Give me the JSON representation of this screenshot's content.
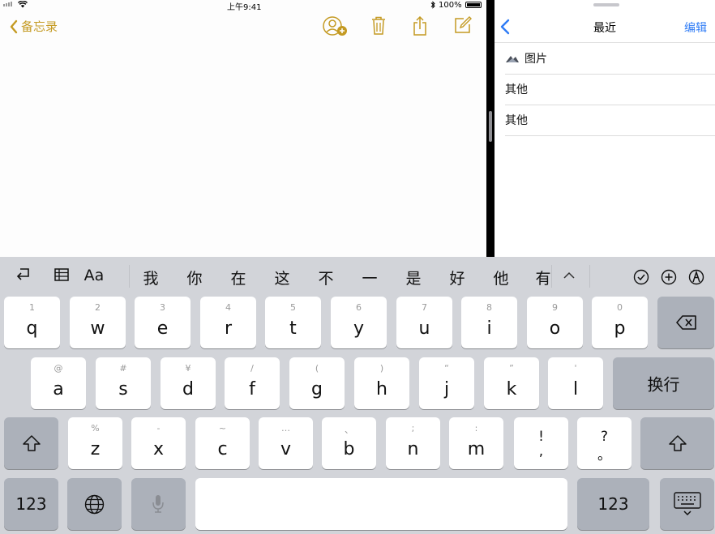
{
  "status": {
    "time": "上午9:41",
    "battery": "100%"
  },
  "notes": {
    "back_label": "备忘录"
  },
  "side": {
    "title": "最近",
    "edit_label": "编辑",
    "rows": [
      {
        "label": "图片",
        "icon": "image-icon"
      },
      {
        "label": "其他"
      },
      {
        "label": "其他"
      }
    ]
  },
  "keyboard": {
    "format_label": "Aa",
    "candidates": [
      "我",
      "你",
      "在",
      "这",
      "不",
      "一",
      "是",
      "好",
      "他",
      "有"
    ],
    "row1": [
      {
        "k": "q",
        "s": "1"
      },
      {
        "k": "w",
        "s": "2"
      },
      {
        "k": "e",
        "s": "3"
      },
      {
        "k": "r",
        "s": "4"
      },
      {
        "k": "t",
        "s": "5"
      },
      {
        "k": "y",
        "s": "6"
      },
      {
        "k": "u",
        "s": "7"
      },
      {
        "k": "i",
        "s": "8"
      },
      {
        "k": "o",
        "s": "9"
      },
      {
        "k": "p",
        "s": "0"
      }
    ],
    "row2": [
      {
        "k": "a",
        "s": "@"
      },
      {
        "k": "s",
        "s": "#"
      },
      {
        "k": "d",
        "s": "¥"
      },
      {
        "k": "f",
        "s": "/"
      },
      {
        "k": "g",
        "s": "("
      },
      {
        "k": "h",
        "s": ")"
      },
      {
        "k": "j",
        "s": "“"
      },
      {
        "k": "k",
        "s": "”"
      },
      {
        "k": "l",
        "s": "'"
      }
    ],
    "row3": [
      {
        "k": "z",
        "s": "%"
      },
      {
        "k": "x",
        "s": "-"
      },
      {
        "k": "c",
        "s": "~"
      },
      {
        "k": "v",
        "s": "…"
      },
      {
        "k": "b",
        "s": "、"
      },
      {
        "k": "n",
        "s": ";"
      },
      {
        "k": "m",
        "s": ":"
      }
    ],
    "punct": [
      {
        "top": "!",
        "bot": ","
      },
      {
        "top": "?",
        "bot": "。"
      }
    ],
    "return_label": "换行",
    "numbers_label": "123"
  }
}
